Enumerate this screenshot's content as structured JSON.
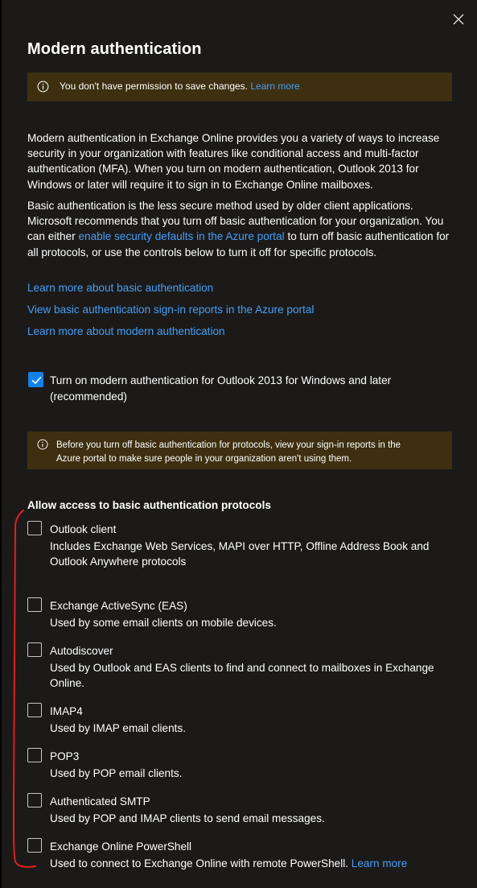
{
  "panel": {
    "title": "Modern authentication",
    "close_icon": "close-icon"
  },
  "permission_banner": {
    "icon": "info-icon",
    "text": "You don't have permission to save changes.",
    "link": "Learn more"
  },
  "description": {
    "paragraph1": "Modern authentication in Exchange Online provides you a variety of ways to increase security in your organization with features like conditional access and multi-factor authentication (MFA). When you turn on modern authentication, Outlook 2013 for Windows or later will require it to sign in to Exchange Online mailboxes.",
    "paragraph2_part1": "Basic authentication is the less secure method used by older client applications. Microsoft recommends that you turn off basic authentication for your organization. You can either",
    "paragraph2_link": "enable security defaults in the Azure portal",
    "paragraph2_part2": "to turn off basic authentication for all protocols, or use the controls below to turn it off for specific protocols."
  },
  "links": {
    "learn_basic": "Learn more about basic authentication",
    "view_reports": "View basic authentication sign-in reports in the Azure portal",
    "learn_modern": "Learn more about modern authentication"
  },
  "modern_auth_toggle": {
    "checked": true,
    "label_line1": "Turn on modern authentication for Outlook 2013 for Windows and later",
    "label_line2": "(recommended)"
  },
  "warning_banner": {
    "icon": "info-icon",
    "line1": "Before you turn off basic authentication for protocols, view your sign-in reports in the",
    "line2": "Azure portal to make sure people in your organization aren't using them."
  },
  "protocols_section": {
    "heading": "Allow access to basic authentication protocols",
    "items": [
      {
        "label": "Outlook client",
        "desc1": "Includes Exchange Web Services, MAPI over HTTP, Offline Address Book and",
        "desc2": "Outlook Anywhere protocols",
        "checked": false
      },
      {
        "label": "Exchange ActiveSync (EAS)",
        "desc1": "Used by some email clients on mobile devices.",
        "desc2": "",
        "checked": false
      },
      {
        "label": "Autodiscover",
        "desc1": "Used by Outlook and EAS clients to find and connect to mailboxes in Exchange",
        "desc2": "Online.",
        "checked": false
      },
      {
        "label": "IMAP4",
        "desc1": "Used by IMAP email clients.",
        "desc2": "",
        "checked": false
      },
      {
        "label": "POP3",
        "desc1": "Used by POP email clients.",
        "desc2": "",
        "checked": false
      },
      {
        "label": "Authenticated SMTP",
        "desc1": "Used by POP and IMAP clients to send email messages.",
        "desc2": "",
        "checked": false
      },
      {
        "label": "Exchange Online PowerShell",
        "desc1": "Used to connect to Exchange Online with remote PowerShell.",
        "desc2": "",
        "link": "Learn more",
        "checked": false
      }
    ]
  },
  "colors": {
    "background": "#1b1a19",
    "link": "#479ef5",
    "banner": "#3d2f10",
    "checkbox_checked": "#1481e6",
    "annotation": "#e02020"
  }
}
